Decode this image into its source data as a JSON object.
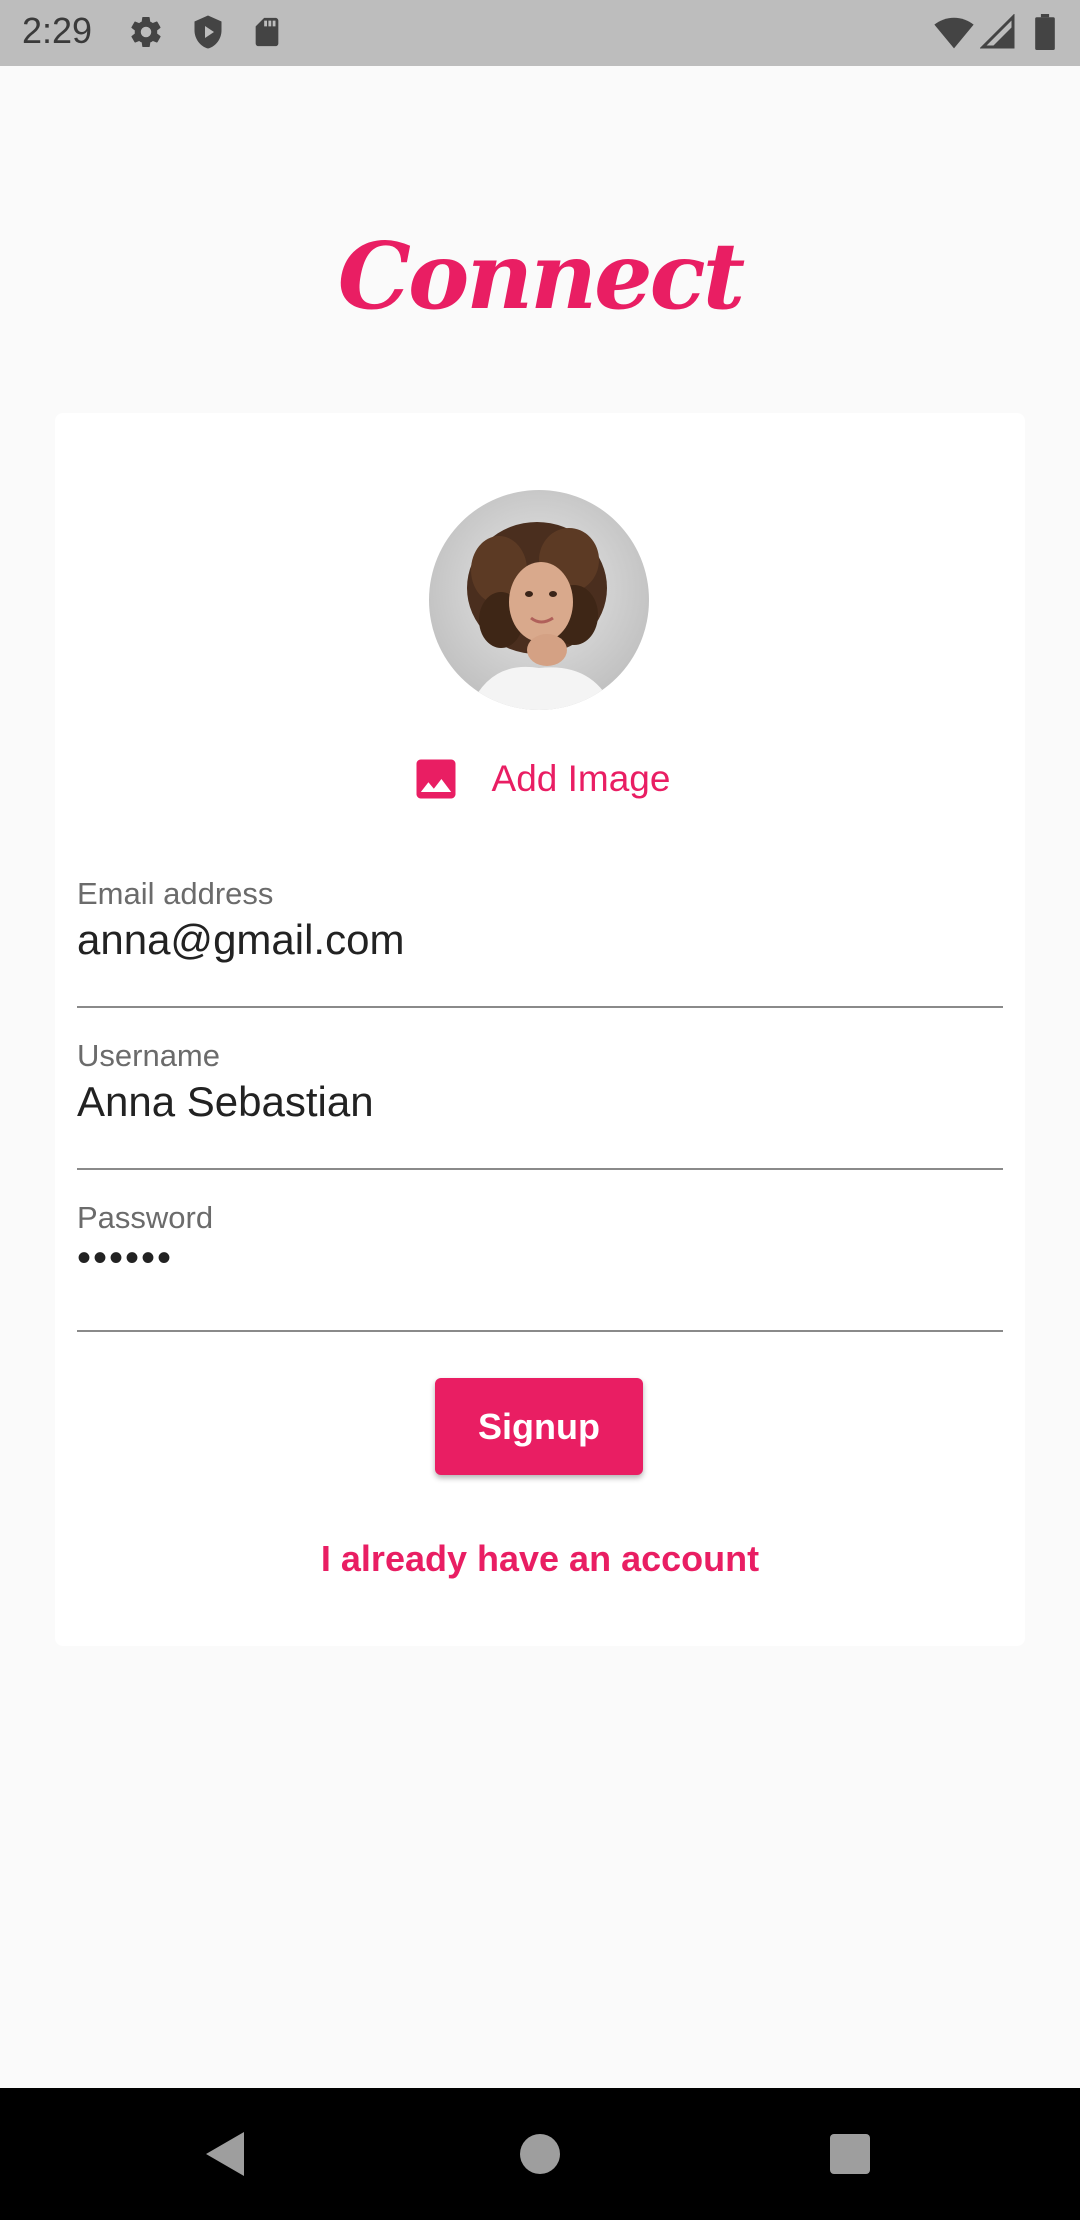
{
  "status_bar": {
    "time": "2:29",
    "icons": [
      "gear-icon",
      "shield-play-icon",
      "sd-card-icon",
      "wifi-icon",
      "signal-icon",
      "battery-icon"
    ]
  },
  "app": {
    "title": "Connect"
  },
  "profile": {
    "add_image_label": "Add Image",
    "avatar_icon": "profile-photo"
  },
  "form": {
    "email": {
      "label": "Email address",
      "value": "anna@gmail.com"
    },
    "username": {
      "label": "Username",
      "value": "Anna Sebastian"
    },
    "password": {
      "label": "Password",
      "value": "••••••"
    }
  },
  "actions": {
    "signup_label": "Signup",
    "login_link": "I already have an account"
  },
  "nav": {
    "icons": [
      "back-icon",
      "home-icon",
      "recents-icon"
    ]
  },
  "colors": {
    "accent": "#e91e63",
    "status_bar": "#bdbdbd",
    "background": "#fafafa"
  }
}
